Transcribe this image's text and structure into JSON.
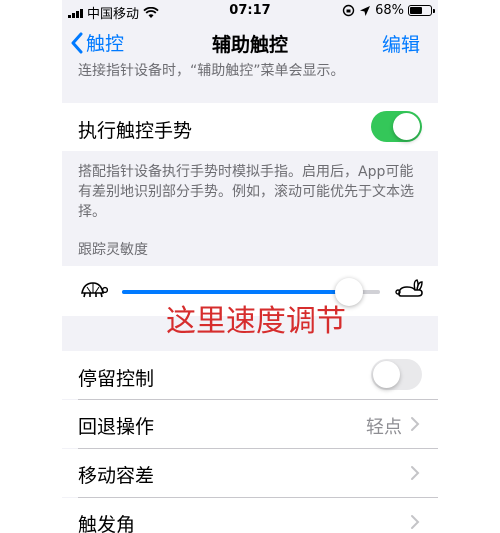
{
  "status_bar": {
    "carrier": "中国移动",
    "time": "07:17",
    "battery": "68%",
    "battery_level": 0.68
  },
  "nav": {
    "back_label": "触控",
    "title": "辅助触控",
    "edit_label": "编辑"
  },
  "cut_note": "连接指针设备时，“辅助触控”菜单会显示。",
  "gesture_cell": {
    "label": "执行触控手势",
    "toggle_on": true
  },
  "gesture_footer": "搭配指针设备执行手势时模拟手指。启用后，App可能有差别地识别部分手势。例如，滚动可能优先于文本选择。",
  "tracking": {
    "header": "跟踪灵敏度",
    "value_fraction": 0.88
  },
  "annotation": "这里速度调节",
  "cells": [
    {
      "label": "停留控制",
      "type": "toggle",
      "toggle_on": false
    },
    {
      "label": "回退操作",
      "type": "disclosure",
      "detail": "轻点"
    },
    {
      "label": "移动容差",
      "type": "disclosure",
      "detail": ""
    },
    {
      "label": "触发角",
      "type": "disclosure",
      "detail": ""
    }
  ],
  "colors": {
    "accent": "#007aff",
    "toggle_on": "#34c759",
    "annotation": "#d62d2d"
  },
  "icons": [
    "wifi-icon",
    "location-icon",
    "lock-rotation-icon",
    "back-chevron-icon",
    "turtle-icon",
    "rabbit-icon",
    "chevron-right-icon"
  ]
}
